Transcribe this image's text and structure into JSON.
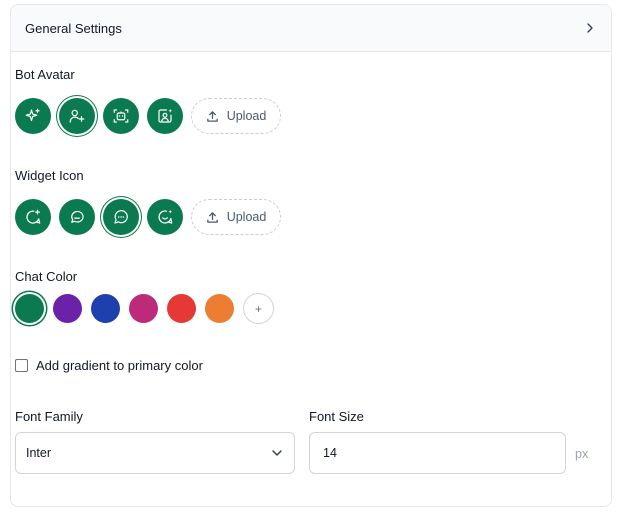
{
  "panel": {
    "title": "General Settings"
  },
  "bot_avatar": {
    "label": "Bot Avatar",
    "icons": [
      "sparkles-icon",
      "user-plus-icon",
      "bot-scan-icon",
      "image-sparkle-icon"
    ],
    "selected_index": 1,
    "upload_label": "Upload"
  },
  "widget_icon": {
    "label": "Widget Icon",
    "icons": [
      "chat-bubble-plus-icon",
      "chat-bubble-icon",
      "chat-bubble-dots-icon",
      "chat-bubble-smile-icon"
    ],
    "selected_index": 2,
    "upload_label": "Upload"
  },
  "chat_color": {
    "label": "Chat Color",
    "colors": [
      "#0b7a50",
      "#6b21a8",
      "#1e40af",
      "#be2a7a",
      "#e53935",
      "#ed7d31"
    ],
    "selected_index": 0,
    "add_label": "+"
  },
  "gradient": {
    "label": "Add gradient to primary color",
    "checked": false
  },
  "font_family": {
    "label": "Font Family",
    "value": "Inter"
  },
  "font_size": {
    "label": "Font Size",
    "value": "14",
    "unit": "px"
  },
  "colors": {
    "accent": "#0b7a50",
    "border": "#e5e7eb",
    "header_bg": "#f9fafb"
  }
}
